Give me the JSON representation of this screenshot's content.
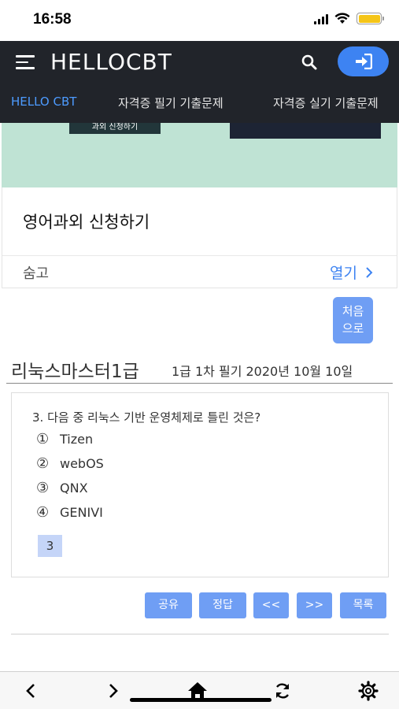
{
  "status_bar": {
    "time": "16:58"
  },
  "header": {
    "app_title": "HELLOCBT",
    "tabs": [
      {
        "label": "HELLO CBT",
        "active": true
      },
      {
        "label": "자격증 필기 기출문제",
        "active": false
      },
      {
        "label": "자격증 실기 기출문제",
        "active": false
      }
    ]
  },
  "banner": {
    "image_caption": "과외 신청하기"
  },
  "ad": {
    "title": "영어과외 신청하기",
    "hide_label": "숨고",
    "open_label": "열기"
  },
  "top_button": {
    "line1": "처음",
    "line2": "으로"
  },
  "exam": {
    "name": "리눅스마스터1급",
    "session": "1급 1차 필기 2020년 10월 10일"
  },
  "question": {
    "text": "3. 다음 중 리눅스 기반 운영체제로 틀린 것은?",
    "options": [
      {
        "num": "①",
        "label": "Tizen"
      },
      {
        "num": "②",
        "label": "webOS"
      },
      {
        "num": "③",
        "label": "QNX"
      },
      {
        "num": "④",
        "label": "GENIVI"
      }
    ],
    "answer": "3"
  },
  "actions": {
    "share": "공유",
    "answer": "정답",
    "prev": "<<",
    "next": ">>",
    "list": "목록"
  },
  "colors": {
    "header_bg": "#21242a",
    "accent": "#3d83f2",
    "button": "#6f9ef4",
    "active_tab": "#4d9bff"
  },
  "icons": [
    "hamburger-icon",
    "search-icon",
    "login-icon",
    "chevron-right-icon",
    "back-icon",
    "forward-icon",
    "home-icon",
    "refresh-icon",
    "gear-icon"
  ]
}
